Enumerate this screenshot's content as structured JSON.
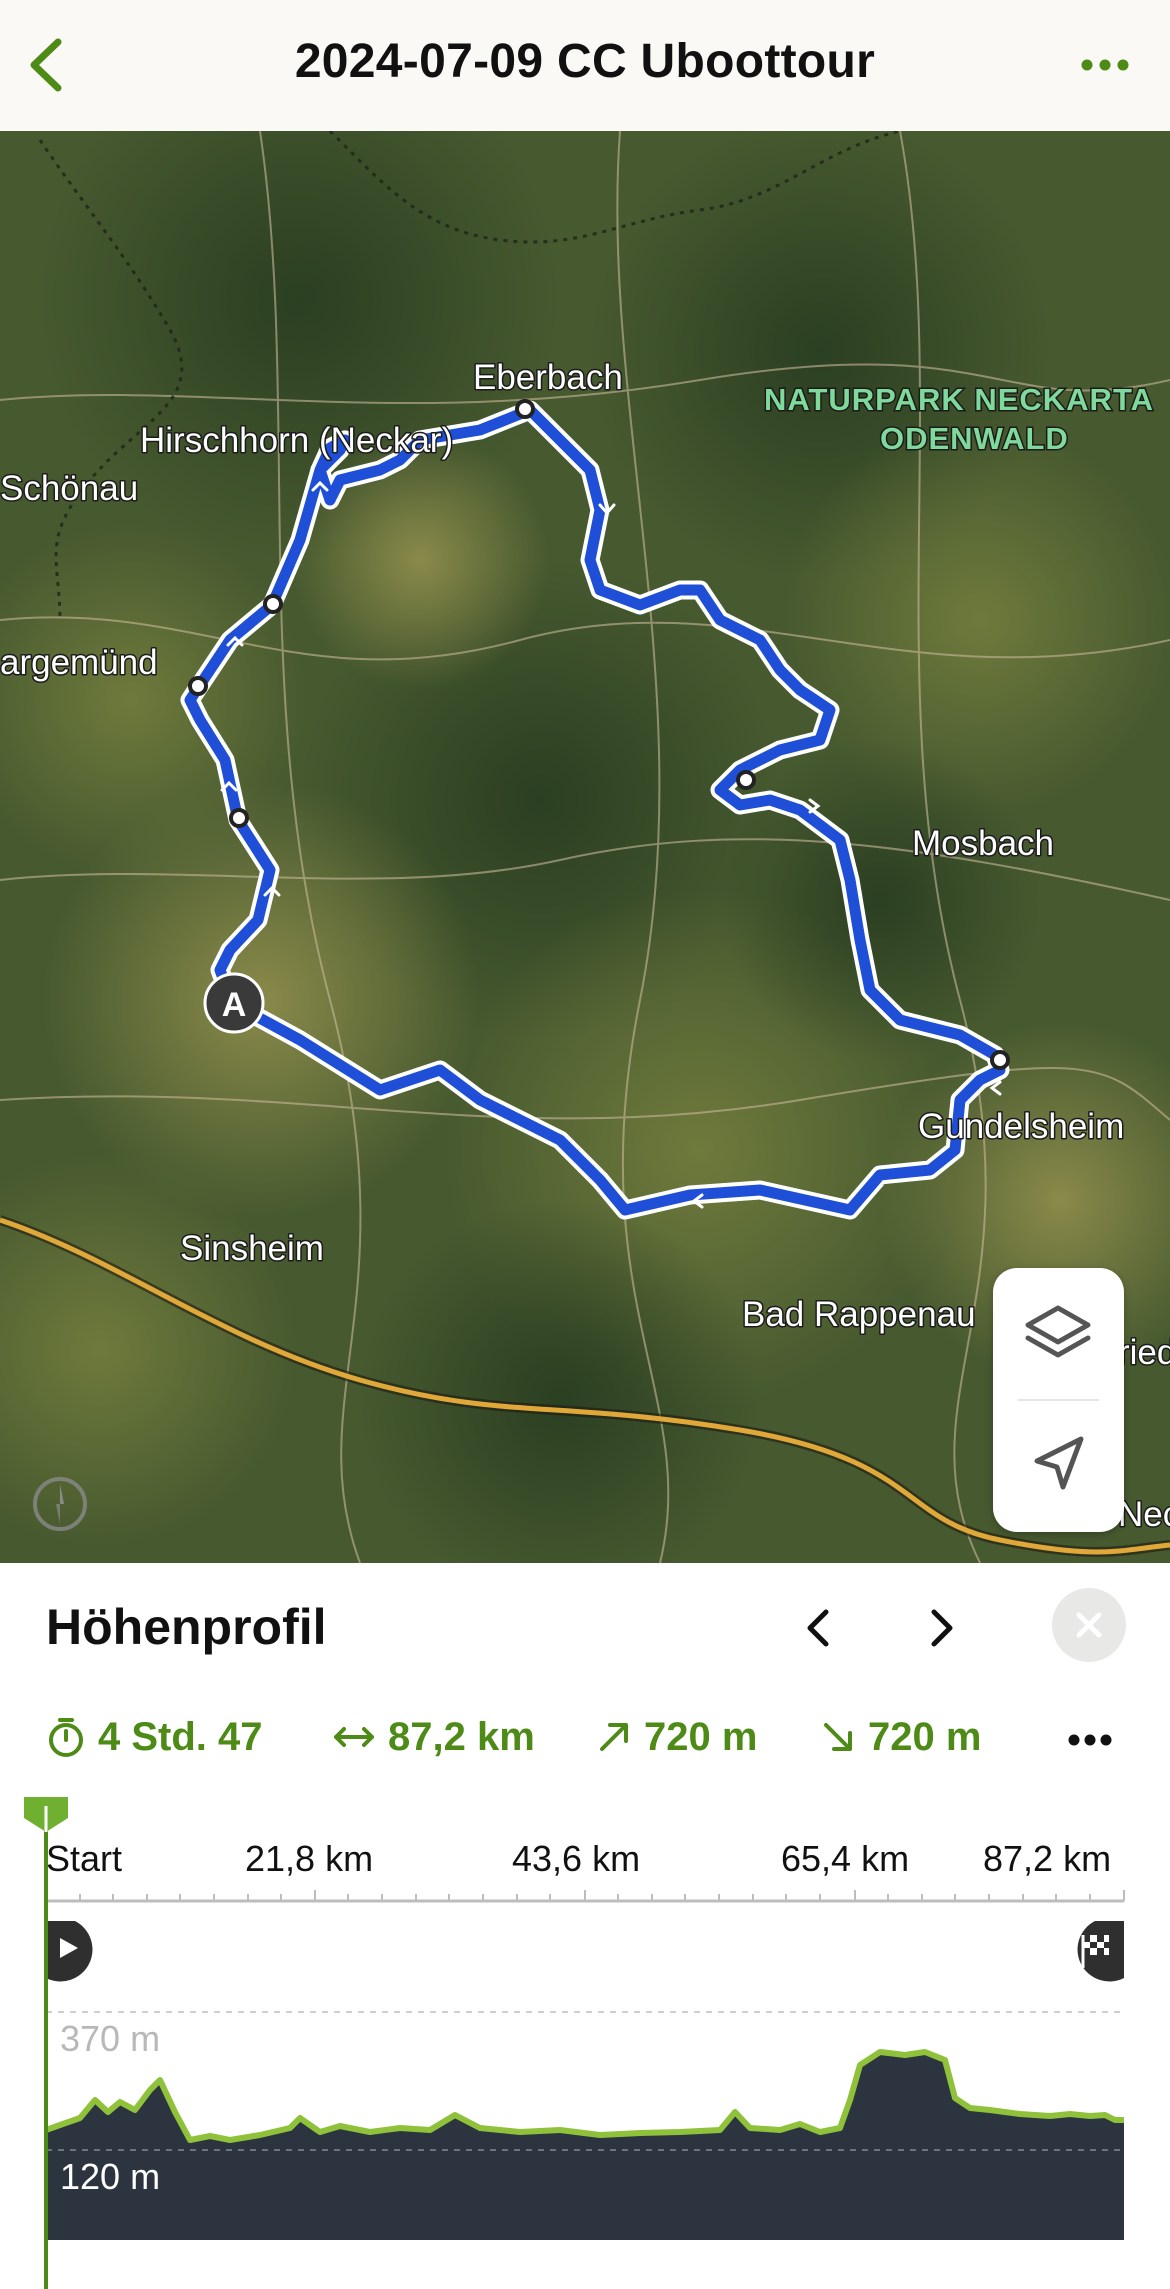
{
  "header": {
    "title": "2024-07-09 CC Uboottour",
    "back_icon": "chevron-left-icon",
    "menu_icon": "ellipsis-icon"
  },
  "colors": {
    "accent_green": "#4e8a16",
    "route_blue": "#1f4fd6",
    "profile_fill": "#2c3440",
    "profile_line": "#8fc23a"
  },
  "map": {
    "labels": {
      "eberbach": "Eberbach",
      "naturpark_line1": "NATURPARK NECKARTA",
      "naturpark_line2": "ODENWALD",
      "hirschhorn": "Hirschhorn (Neckar)",
      "schoenau": "Schönau",
      "neckargemuend": "argemünd",
      "mosbach": "Mosbach",
      "gundelsheim": "Gundelsheim",
      "sinsheim": "Sinsheim",
      "bad_rappenau": "Bad Rappenau",
      "ried": "ried",
      "nec": "Nec"
    },
    "start_marker": "A",
    "layers_icon": "layers-icon",
    "locate_icon": "location-arrow-icon",
    "compass_icon": "compass-icon"
  },
  "profile": {
    "title": "Höhenprofil",
    "prev_icon": "chevron-left-icon",
    "next_icon": "chevron-right-icon",
    "close_icon": "close-icon",
    "stats": {
      "duration": "4 Std. 47",
      "distance": "87,2 km",
      "ascent": "720 m",
      "descent": "720 m"
    },
    "more_icon": "ellipsis-icon",
    "x_ticks": [
      "Start",
      "21,8 km",
      "43,6 km",
      "65,4 km",
      "87,2 km"
    ],
    "y_labels": {
      "high": "370 m",
      "low": "120 m"
    },
    "start_icon": "play-icon",
    "finish_icon": "finish-flag-icon"
  }
}
